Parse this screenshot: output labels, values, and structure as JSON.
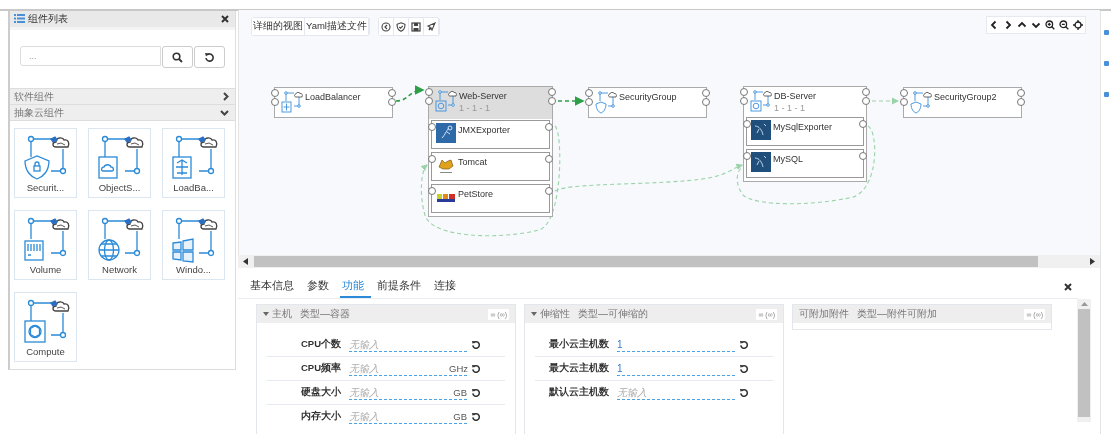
{
  "component_panel": {
    "title": "组件列表",
    "search": {
      "placeholder": "..."
    },
    "categories": [
      {
        "label": "软件组件",
        "expanded": false
      },
      {
        "label": "抽象云组件",
        "expanded": true
      }
    ],
    "components": [
      {
        "label": "Securit...",
        "kind": "shield"
      },
      {
        "label": "ObjectS...",
        "kind": "storage"
      },
      {
        "label": "LoadBa...",
        "kind": "loadbalancer"
      },
      {
        "label": "Volume",
        "kind": "volume"
      },
      {
        "label": "Network",
        "kind": "network"
      },
      {
        "label": "Windo...",
        "kind": "windows"
      },
      {
        "label": "Compute",
        "kind": "compute"
      }
    ]
  },
  "toolbar": {
    "view_buttons": [
      "详细的视图",
      "Yaml描述文件"
    ]
  },
  "topology": {
    "nodes": [
      {
        "label": "LoadBalancer",
        "kind": "loadbalancer",
        "selected": false
      },
      {
        "label": "Web-Server",
        "kind": "compute",
        "instances": "1 - 1 - 1",
        "selected": true,
        "children": [
          {
            "label": "JMXExporter",
            "kind": "jmx"
          },
          {
            "label": "Tomcat",
            "kind": "tomcat"
          },
          {
            "label": "PetStore",
            "kind": "petstore"
          }
        ]
      },
      {
        "label": "SecurityGroup",
        "kind": "shield",
        "selected": false
      },
      {
        "label": "DB-Server",
        "kind": "compute",
        "instances": "1 - 1 - 1",
        "selected": false,
        "children": [
          {
            "label": "MySqlExporter",
            "kind": "mysql"
          },
          {
            "label": "MySQL",
            "kind": "mysql"
          }
        ]
      },
      {
        "label": "SecurityGroup2",
        "kind": "shield",
        "selected": false
      }
    ]
  },
  "details": {
    "tabs": [
      {
        "label": "基本信息",
        "selected": false
      },
      {
        "label": "参数",
        "selected": false
      },
      {
        "label": "功能",
        "selected": true
      },
      {
        "label": "前提条件",
        "selected": false
      },
      {
        "label": "连接",
        "selected": false
      }
    ],
    "panels": [
      {
        "title": "主机",
        "type": "类型—容器",
        "expanded": true,
        "count": "∞ (∞)",
        "fields": [
          {
            "label": "CPU个数",
            "placeholder": "无输入"
          },
          {
            "label": "CPU频率",
            "placeholder": "无输入",
            "unit": "GHz"
          },
          {
            "label": "硬盘大小",
            "placeholder": "无输入",
            "unit": "GB"
          },
          {
            "label": "内存大小",
            "placeholder": "无输入",
            "unit": "GB"
          }
        ]
      },
      {
        "title": "伸缩性",
        "type": "类型—可伸缩的",
        "expanded": true,
        "count": "∞ (∞)",
        "fields": [
          {
            "label": "最小云主机数",
            "value": "1"
          },
          {
            "label": "最大云主机数",
            "value": "1"
          },
          {
            "label": "默认云主机数",
            "placeholder": "无输入"
          }
        ]
      },
      {
        "title": "可附加附件",
        "type": "类型—附件可附加",
        "expanded": false,
        "count": "∞ (∞)"
      }
    ]
  }
}
